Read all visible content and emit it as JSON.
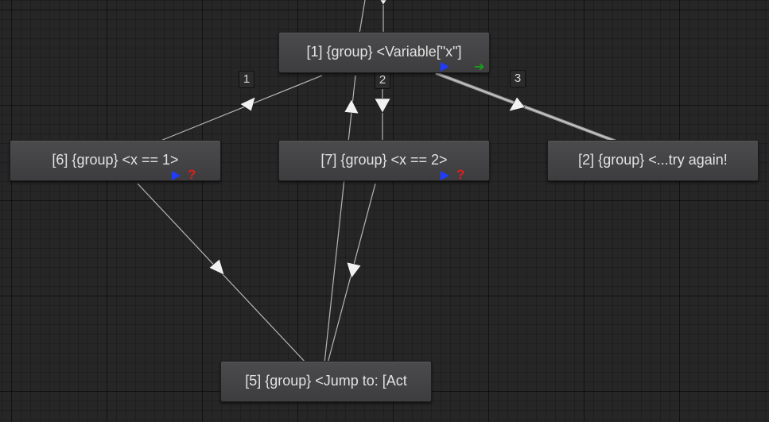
{
  "nodes": {
    "n1": {
      "title": "[1] {group} <Variable[\"x\"]"
    },
    "n6": {
      "title": "[6] {group} <x == 1>"
    },
    "n7": {
      "title": "[7] {group} <x == 2>"
    },
    "n2": {
      "title": "[2] {group} <...try again!"
    },
    "n5": {
      "title": "[5] {group} <Jump to: [Act"
    }
  },
  "branch_labels": {
    "b1": "1",
    "b2": "2",
    "b3": "3"
  },
  "icons": {
    "play": "play-icon",
    "continue": "green-arrow-icon",
    "condition": "question-icon"
  },
  "colors": {
    "canvas": "#262626",
    "node": "#454547",
    "connection": "#b8b8b8",
    "play": "#1d3cff",
    "continue": "#18a018",
    "condition": "#e01c1c"
  }
}
